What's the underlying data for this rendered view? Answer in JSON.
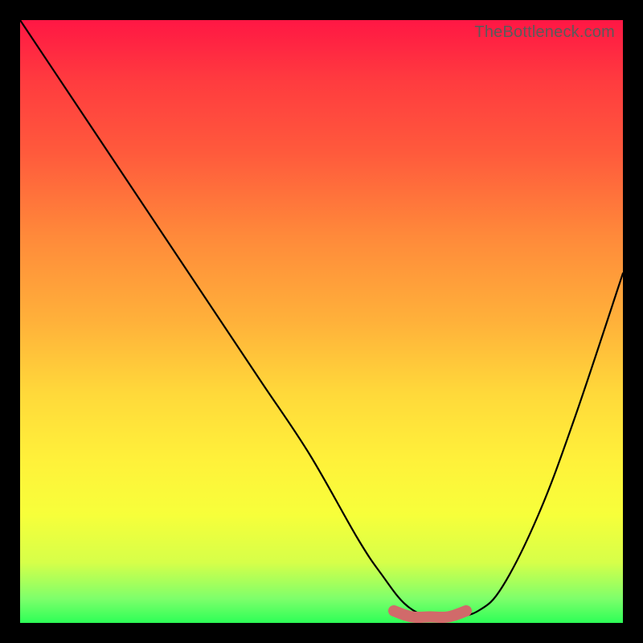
{
  "watermark": "TheBottleneck.com",
  "chart_data": {
    "type": "line",
    "title": "",
    "xlabel": "",
    "ylabel": "",
    "xlim": [
      0,
      100
    ],
    "ylim": [
      0,
      100
    ],
    "grid": false,
    "legend": false,
    "series": [
      {
        "name": "bottleneck-curve",
        "x": [
          0,
          8,
          16,
          24,
          32,
          40,
          48,
          56,
          60,
          64,
          68,
          72,
          76,
          80,
          86,
          92,
          100
        ],
        "y": [
          100,
          88,
          76,
          64,
          52,
          40,
          28,
          14,
          8,
          3,
          1,
          1,
          2,
          6,
          18,
          34,
          58
        ]
      },
      {
        "name": "optimal-marker",
        "x": [
          62,
          65,
          68,
          71,
          74
        ],
        "y": [
          2,
          1,
          1,
          1,
          2
        ]
      }
    ],
    "gradient_stops": [
      {
        "pos": 0,
        "color": "#ff1744"
      },
      {
        "pos": 10,
        "color": "#ff3b3f"
      },
      {
        "pos": 22,
        "color": "#ff5a3c"
      },
      {
        "pos": 36,
        "color": "#ff8a3a"
      },
      {
        "pos": 50,
        "color": "#ffb13a"
      },
      {
        "pos": 62,
        "color": "#ffd93a"
      },
      {
        "pos": 73,
        "color": "#fff13a"
      },
      {
        "pos": 82,
        "color": "#f7ff3a"
      },
      {
        "pos": 90,
        "color": "#d6ff49"
      },
      {
        "pos": 96,
        "color": "#7dff6b"
      },
      {
        "pos": 100,
        "color": "#2dff57"
      }
    ],
    "colors": {
      "curve": "#000000",
      "marker": "#d16a6a",
      "frame": "#000000"
    }
  }
}
